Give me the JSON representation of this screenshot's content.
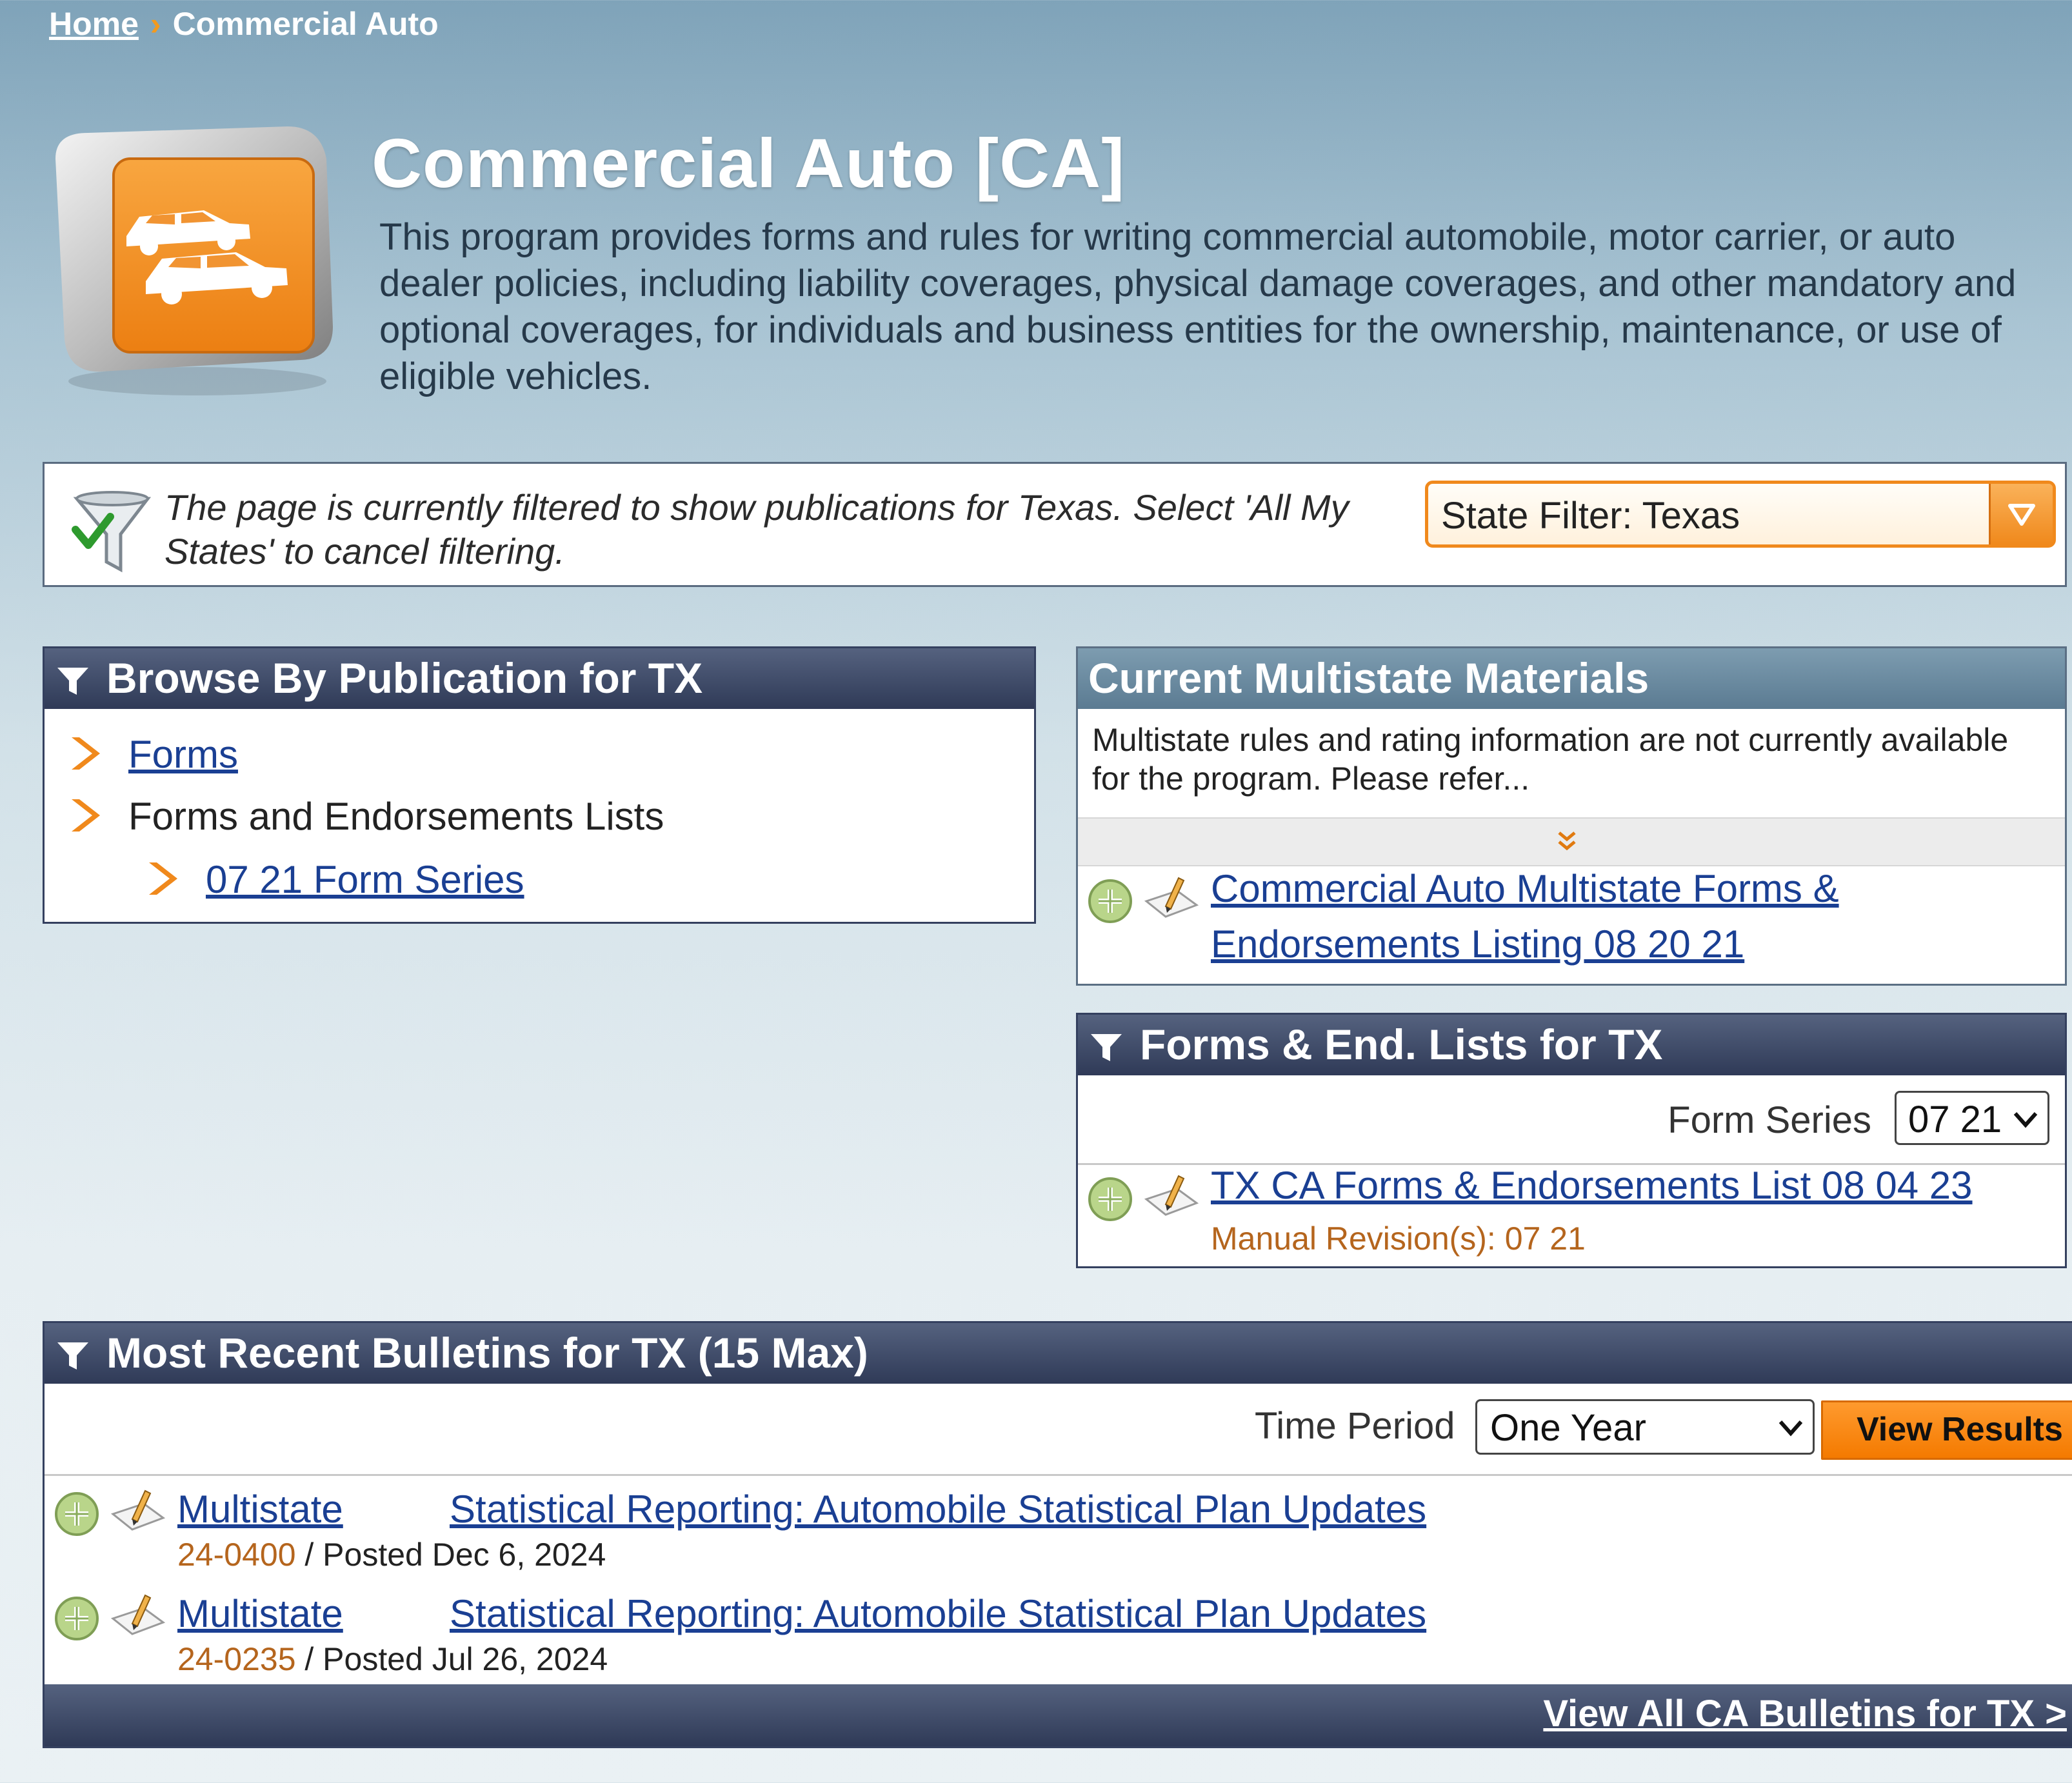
{
  "breadcrumb": {
    "home": "Home",
    "separator": "›",
    "current": "Commercial Auto"
  },
  "header": {
    "title": "Commercial Auto [CA]",
    "description": "This program provides forms and rules for writing commercial automobile, motor carrier, or auto dealer policies, including liability coverages, physical damage coverages, and other mandatory and optional coverages, for individuals and business entities for the ownership, maintenance, or use of eligible vehicles."
  },
  "filter": {
    "message": "The page is currently filtered to show publications for Texas. Select 'All My States' to cancel filtering.",
    "state_filter_label": "State Filter: Texas"
  },
  "browse": {
    "title": "Browse By Publication for TX",
    "items": [
      {
        "label": "Forms"
      },
      {
        "label": "Forms and Endorsements Lists"
      },
      {
        "label": "07 21 Form Series"
      }
    ]
  },
  "multistate": {
    "title": "Current Multistate Materials",
    "note": "Multistate rules and rating information are not currently available for the program. Please refer...",
    "link_line1": "Commercial Auto Multistate Forms &",
    "link_line2": "Endorsements Listing 08 20 21"
  },
  "forms_lists": {
    "title": "Forms & End. Lists for TX",
    "series_label": "Form Series",
    "series_value": "07 21",
    "link": "TX CA Forms & Endorsements List 08 04 23",
    "revision": "Manual Revision(s): 07 21"
  },
  "bulletins": {
    "title": "Most Recent Bulletins for TX (15 Max)",
    "time_period_label": "Time Period",
    "time_period_value": "One Year",
    "view_results": "View Results",
    "items": [
      {
        "source": "Multistate",
        "title": "Statistical Reporting: Automobile Statistical Plan Updates",
        "number": "24-0400",
        "posted": " / Posted Dec 6, 2024"
      },
      {
        "source": "Multistate",
        "title": "Statistical Reporting: Automobile Statistical Plan Updates",
        "number": "24-0235",
        "posted": " / Posted Jul 26, 2024"
      }
    ],
    "view_all": "View All CA Bulletins for TX >"
  },
  "colors": {
    "accent_orange": "#f0891c",
    "panel_navy": "#2f3a57",
    "link_blue": "#1a3f93"
  }
}
